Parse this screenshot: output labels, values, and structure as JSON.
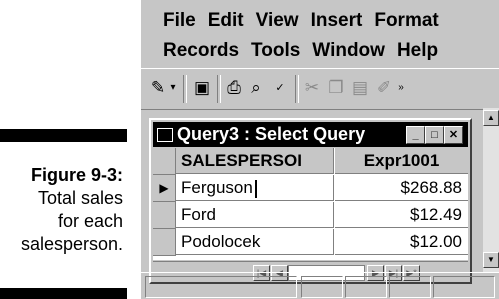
{
  "caption": {
    "figure": "Figure 9-3:",
    "lines": [
      "Total sales",
      "for each",
      "salesperson."
    ]
  },
  "menu": {
    "row1": [
      "File",
      "Edit",
      "View",
      "Insert",
      "Format"
    ],
    "row2": [
      "Records",
      "Tools",
      "Window",
      "Help"
    ]
  },
  "toolbar": {
    "icons": [
      "design-view-icon",
      "dropdown-arrow-icon",
      "save-icon",
      "print-icon",
      "print-preview-icon",
      "spelling-icon",
      "cut-icon",
      "copy-icon",
      "paste-icon",
      "format-painter-icon",
      "more-buttons-icon"
    ]
  },
  "query_window": {
    "title": "Query3 : Select Query",
    "columns": [
      "SALESPERSOI",
      "Expr1001"
    ],
    "rows": [
      {
        "salesperson": "Ferguson",
        "expr": "$268.88"
      },
      {
        "salesperson": "Ford",
        "expr": "$12.49"
      },
      {
        "salesperson": "Podolocek",
        "expr": "$12.00"
      }
    ]
  },
  "colors": {
    "title_bar": "#000000",
    "window_face": "#c6c6c6"
  }
}
